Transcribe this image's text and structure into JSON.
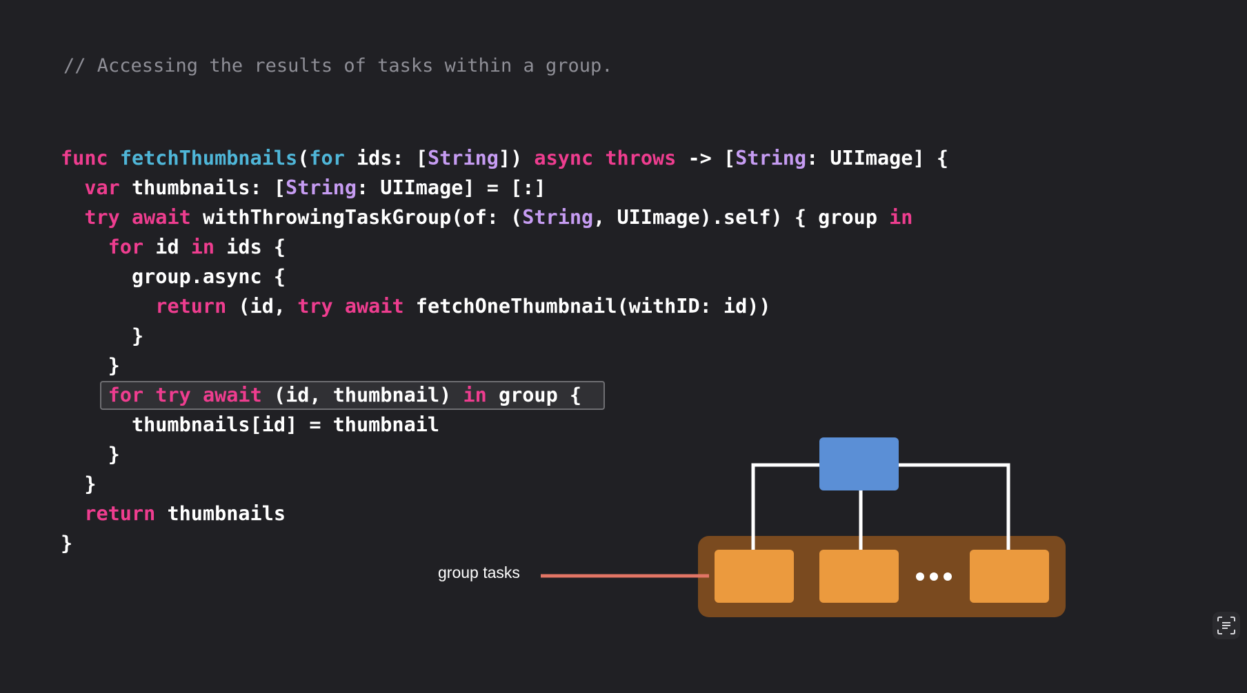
{
  "comment": "// Accessing the results of tasks within a group.",
  "code_lines": [
    [
      [
        "kw",
        "func"
      ],
      [
        "pl",
        " "
      ],
      [
        "fn",
        "fetchThumbnails"
      ],
      [
        "pl",
        "("
      ],
      [
        "fn",
        "for"
      ],
      [
        "pl",
        " ids: ["
      ],
      [
        "ty",
        "String"
      ],
      [
        "pl",
        "]) "
      ],
      [
        "kw",
        "async"
      ],
      [
        "pl",
        " "
      ],
      [
        "kw",
        "throws"
      ],
      [
        "pl",
        " -> ["
      ],
      [
        "ty",
        "String"
      ],
      [
        "pl",
        ": UIImage] {"
      ]
    ],
    [
      [
        "pl",
        "  "
      ],
      [
        "kw",
        "var"
      ],
      [
        "pl",
        " thumbnails: ["
      ],
      [
        "ty",
        "String"
      ],
      [
        "pl",
        ": UIImage] = [:]"
      ]
    ],
    [
      [
        "pl",
        "  "
      ],
      [
        "kw",
        "try"
      ],
      [
        "pl",
        " "
      ],
      [
        "kw",
        "await"
      ],
      [
        "pl",
        " withThrowingTaskGroup(of: ("
      ],
      [
        "ty",
        "String"
      ],
      [
        "pl",
        ", UIImage).self) { group "
      ],
      [
        "kw",
        "in"
      ]
    ],
    [
      [
        "pl",
        "    "
      ],
      [
        "kw",
        "for"
      ],
      [
        "pl",
        " id "
      ],
      [
        "kw",
        "in"
      ],
      [
        "pl",
        " ids {"
      ]
    ],
    [
      [
        "pl",
        "      group.async {"
      ]
    ],
    [
      [
        "pl",
        "        "
      ],
      [
        "kw",
        "return"
      ],
      [
        "pl",
        " (id, "
      ],
      [
        "kw",
        "try"
      ],
      [
        "pl",
        " "
      ],
      [
        "kw",
        "await"
      ],
      [
        "pl",
        " fetchOneThumbnail(withID: id))"
      ]
    ],
    [
      [
        "pl",
        "      }"
      ]
    ],
    [
      [
        "pl",
        "    }"
      ]
    ],
    [
      [
        "pl",
        "    "
      ],
      [
        "kw",
        "for"
      ],
      [
        "pl",
        " "
      ],
      [
        "kw",
        "try"
      ],
      [
        "pl",
        " "
      ],
      [
        "kw",
        "await"
      ],
      [
        "pl",
        " (id, thumbnail) "
      ],
      [
        "kw",
        "in"
      ],
      [
        "pl",
        " group {"
      ]
    ],
    [
      [
        "pl",
        "      thumbnails[id] = thumbnail"
      ]
    ],
    [
      [
        "pl",
        "    }"
      ]
    ],
    [
      [
        "pl",
        "  }"
      ]
    ],
    [
      [
        "pl",
        "  "
      ],
      [
        "kw",
        "return"
      ],
      [
        "pl",
        " thumbnails"
      ]
    ],
    [
      [
        "pl",
        "}"
      ]
    ]
  ],
  "diagram": {
    "label": "group tasks",
    "ellipsis": "•••",
    "colors": {
      "parent": "#5b8fd6",
      "child": "#eb9a3e",
      "container": "#7a4a1f",
      "connector": "#ffffff",
      "pointer": "#e27565"
    }
  },
  "icons": {
    "live_text": "text-scan-icon"
  }
}
